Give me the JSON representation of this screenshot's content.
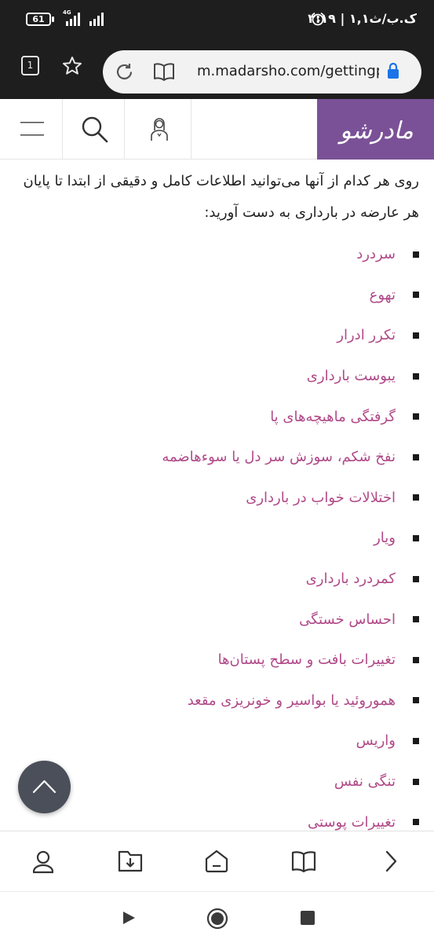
{
  "status_bar": {
    "battery": "61",
    "network": "4G",
    "time": "۳:۱۹ | ۱,۱ک.ب/ث"
  },
  "browser": {
    "tab_count": "1",
    "url": "m.madarsho.com/gettingpregnant",
    "icons": [
      "star-icon",
      "reload-icon",
      "reader-mode-icon",
      "lock-icon"
    ]
  },
  "site": {
    "logo_text": "مادرشو",
    "brand_color": "#7a5197",
    "link_color": "#b04a88"
  },
  "article": {
    "intro": "روی هر کدام از آنها می‌توانید اطلاعات کامل و دقیقی از ابتدا تا پایان هر عارضه در بارداری به دست آورید:",
    "symptoms": [
      "سردرد",
      "تهوع",
      "تکرر ادرار",
      "یبوست بارداری",
      "گرفتگی ماهیچه‌های پا",
      "نفخ شکم، سوزش سر دل یا سوءهاضمه",
      "اختلالات خواب در بارداری",
      "ویار",
      "کمردرد بارداری",
      "احساس خستگی",
      "تغییرات بافت و سطح پستان‌ها",
      "هموروئید یا بواسیر و خونریزی مقعد",
      "واریس",
      "تنگی نفس",
      "تغییرات پوستی"
    ]
  }
}
